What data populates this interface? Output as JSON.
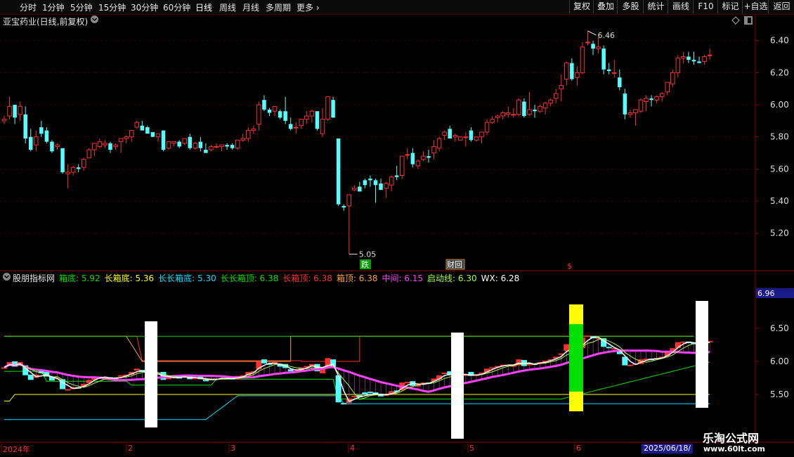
{
  "toolbar": {
    "periods": [
      "分时",
      "1分钟",
      "5分钟",
      "15分钟",
      "30分钟",
      "60分钟",
      "日线",
      "周线",
      "月线",
      "多周期",
      "更多 ›"
    ],
    "buttons": [
      "复权",
      "叠加",
      "多股",
      "统计",
      "画线",
      "F10",
      "标记",
      "+自选",
      "返回"
    ]
  },
  "main": {
    "title": "亚宝药业(日线,前复权)",
    "high_label": "6.46",
    "low_label": "5.05",
    "marker_die": "跌",
    "marker_caiji": "财回",
    "marker_s": "$",
    "y_ticks": [
      "6.40",
      "6.20",
      "6.00",
      "5.80",
      "5.60",
      "5.40",
      "5.20"
    ]
  },
  "indicator": {
    "name": "股朋指标网",
    "items": [
      {
        "label": "箱底:",
        "value": "5.92",
        "color": "#00e000"
      },
      {
        "label": "长箱底:",
        "value": "5.36",
        "color": "#ffff00"
      },
      {
        "label": "长长箱底:",
        "value": "5.30",
        "color": "#00e0ff"
      },
      {
        "label": "长长箱顶:",
        "value": "6.38",
        "color": "#00e000"
      },
      {
        "label": "长箱顶:",
        "value": "6.38",
        "color": "#ff3030"
      },
      {
        "label": "箱顶:",
        "value": "6.38",
        "color": "#ffa040"
      },
      {
        "label": "中间:",
        "value": "6.15",
        "color": "#ff40ff"
      },
      {
        "label": "启动线:",
        "value": "6.30",
        "color": "#a0ff40"
      },
      {
        "label": "WX:",
        "value": "6.28",
        "color": "#ffffff"
      }
    ],
    "y_ticks": [
      "6.96",
      "6.50",
      "6.00",
      "5.50"
    ]
  },
  "x_axis": {
    "labels": [
      "2024年",
      "2",
      "3",
      "4",
      "5",
      "6"
    ],
    "date_box": "2025/06/18/"
  },
  "watermark": {
    "line1": "乐淘公式网",
    "line2": "www.60lt.com"
  },
  "colors": {
    "up": "#ff3030",
    "down": "#54ffff",
    "grid": "#8b0000",
    "magenta": "#ff40ff"
  },
  "chart_data": {
    "type": "candlestick",
    "ylim": [
      5.05,
      6.46
    ],
    "ohlc": [
      [
        5.9,
        5.93,
        5.88,
        5.91
      ],
      [
        5.93,
        6.05,
        5.91,
        5.99
      ],
      [
        6.0,
        6.0,
        5.88,
        5.92
      ],
      [
        5.94,
        6.02,
        5.9,
        5.99
      ],
      [
        5.94,
        5.99,
        5.76,
        5.79
      ],
      [
        5.8,
        5.85,
        5.71,
        5.72
      ],
      [
        5.75,
        5.84,
        5.71,
        5.8
      ],
      [
        5.86,
        5.9,
        5.8,
        5.82
      ],
      [
        5.84,
        5.86,
        5.76,
        5.77
      ],
      [
        5.77,
        5.78,
        5.7,
        5.71
      ],
      [
        5.74,
        5.76,
        5.72,
        5.75
      ],
      [
        5.73,
        5.73,
        5.57,
        5.58
      ],
      [
        5.57,
        5.63,
        5.48,
        5.58
      ],
      [
        5.58,
        5.62,
        5.56,
        5.61
      ],
      [
        5.61,
        5.63,
        5.58,
        5.6
      ],
      [
        5.61,
        5.67,
        5.59,
        5.66
      ],
      [
        5.67,
        5.73,
        5.67,
        5.72
      ],
      [
        5.72,
        5.75,
        5.68,
        5.76
      ],
      [
        5.74,
        5.79,
        5.73,
        5.77
      ],
      [
        5.75,
        5.78,
        5.73,
        5.76
      ],
      [
        5.76,
        5.77,
        5.7,
        5.72
      ],
      [
        5.74,
        5.76,
        5.72,
        5.75
      ],
      [
        5.77,
        5.79,
        5.7,
        5.79
      ],
      [
        5.79,
        5.81,
        5.76,
        5.8
      ],
      [
        5.8,
        5.81,
        5.77,
        5.84
      ],
      [
        5.86,
        5.9,
        5.85,
        5.89
      ],
      [
        5.87,
        5.9,
        5.84,
        5.84
      ],
      [
        5.86,
        5.87,
        5.83,
        5.82
      ],
      [
        5.83,
        5.83,
        5.8,
        5.8
      ],
      [
        5.8,
        5.81,
        5.77,
        5.82
      ],
      [
        5.84,
        5.84,
        5.71,
        5.72
      ],
      [
        5.73,
        5.77,
        5.72,
        5.77
      ],
      [
        5.76,
        5.77,
        5.74,
        5.77
      ],
      [
        5.77,
        5.78,
        5.73,
        5.74
      ],
      [
        5.76,
        5.79,
        5.75,
        5.79
      ],
      [
        5.8,
        5.82,
        5.72,
        5.73
      ],
      [
        5.73,
        5.77,
        5.72,
        5.76
      ],
      [
        5.77,
        5.8,
        5.71,
        5.73
      ],
      [
        5.72,
        5.76,
        5.7,
        5.7
      ],
      [
        5.72,
        5.75,
        5.71,
        5.74
      ],
      [
        5.74,
        5.76,
        5.73,
        5.74
      ],
      [
        5.74,
        5.75,
        5.71,
        5.75
      ],
      [
        5.75,
        5.76,
        5.72,
        5.74
      ],
      [
        5.75,
        5.76,
        5.72,
        5.73
      ],
      [
        5.73,
        5.78,
        5.72,
        5.78
      ],
      [
        5.78,
        5.82,
        5.77,
        5.79
      ],
      [
        5.79,
        5.86,
        5.77,
        5.84
      ],
      [
        5.84,
        5.87,
        5.82,
        5.85
      ],
      [
        5.88,
        6.02,
        5.84,
        6.0
      ],
      [
        6.03,
        6.06,
        5.96,
        5.97
      ],
      [
        5.97,
        5.98,
        5.93,
        5.95
      ],
      [
        5.96,
        5.99,
        5.93,
        5.99
      ],
      [
        5.96,
        5.97,
        5.91,
        5.92
      ],
      [
        5.96,
        6.05,
        5.88,
        5.9
      ],
      [
        5.88,
        5.92,
        5.84,
        5.85
      ],
      [
        5.86,
        5.89,
        5.82,
        5.86
      ],
      [
        5.87,
        5.91,
        5.85,
        5.91
      ],
      [
        5.91,
        5.96,
        5.88,
        5.93
      ],
      [
        5.93,
        5.97,
        5.89,
        5.96
      ],
      [
        5.96,
        5.96,
        5.84,
        5.85
      ],
      [
        5.82,
        5.98,
        5.8,
        5.91
      ],
      [
        5.91,
        6.04,
        5.9,
        6.05
      ],
      [
        6.03,
        6.05,
        5.92,
        5.92
      ],
      [
        5.79,
        5.79,
        5.37,
        5.38
      ],
      [
        5.37,
        5.38,
        5.34,
        5.36
      ],
      [
        5.37,
        5.43,
        5.07,
        5.44
      ],
      [
        5.47,
        5.5,
        5.46,
        5.48
      ],
      [
        5.49,
        5.52,
        5.46,
        5.46
      ],
      [
        5.53,
        5.54,
        5.48,
        5.5
      ],
      [
        5.54,
        5.56,
        5.49,
        5.53
      ],
      [
        5.53,
        5.54,
        5.39,
        5.5
      ],
      [
        5.51,
        5.54,
        5.48,
        5.47
      ],
      [
        5.48,
        5.52,
        5.42,
        5.51
      ],
      [
        5.5,
        5.56,
        5.46,
        5.55
      ],
      [
        5.56,
        5.62,
        5.53,
        5.55
      ],
      [
        5.56,
        5.63,
        5.54,
        5.68
      ],
      [
        5.69,
        5.73,
        5.66,
        5.69
      ],
      [
        5.7,
        5.73,
        5.61,
        5.63
      ],
      [
        5.62,
        5.66,
        5.6,
        5.65
      ],
      [
        5.66,
        5.71,
        5.65,
        5.68
      ],
      [
        5.68,
        5.72,
        5.64,
        5.67
      ],
      [
        5.7,
        5.78,
        5.66,
        5.74
      ],
      [
        5.73,
        5.8,
        5.71,
        5.79
      ],
      [
        5.81,
        5.84,
        5.78,
        5.83
      ],
      [
        5.85,
        5.87,
        5.79,
        5.79
      ],
      [
        5.8,
        5.82,
        5.77,
        5.81
      ],
      [
        5.78,
        5.8,
        5.78,
        5.8
      ],
      [
        5.8,
        5.83,
        5.74,
        5.8
      ],
      [
        5.84,
        5.86,
        5.77,
        5.78
      ],
      [
        5.78,
        5.8,
        5.77,
        5.8
      ],
      [
        5.8,
        5.83,
        5.76,
        5.83
      ],
      [
        5.83,
        5.91,
        5.81,
        5.89
      ],
      [
        5.89,
        5.93,
        5.88,
        5.91
      ],
      [
        5.92,
        5.94,
        5.89,
        5.93
      ],
      [
        5.93,
        5.96,
        5.91,
        5.95
      ],
      [
        5.94,
        5.99,
        5.92,
        5.95
      ],
      [
        5.94,
        5.98,
        5.92,
        5.94
      ],
      [
        5.94,
        6.04,
        5.93,
        6.03
      ],
      [
        6.02,
        6.04,
        5.92,
        5.93
      ],
      [
        5.94,
        6.08,
        5.93,
        5.97
      ],
      [
        5.97,
        6.0,
        5.92,
        5.96
      ],
      [
        5.96,
        6.0,
        5.95,
        5.99
      ],
      [
        5.98,
        6.02,
        5.94,
        6.01
      ],
      [
        6.01,
        6.04,
        5.99,
        6.03
      ],
      [
        6.04,
        6.1,
        6.01,
        6.07
      ],
      [
        6.1,
        6.19,
        6.02,
        6.12
      ],
      [
        6.16,
        6.27,
        6.12,
        6.26
      ],
      [
        6.26,
        6.29,
        6.15,
        6.16
      ],
      [
        6.17,
        6.24,
        6.12,
        6.2
      ],
      [
        6.2,
        6.39,
        6.19,
        6.36
      ],
      [
        6.39,
        6.46,
        6.37,
        6.39
      ],
      [
        6.38,
        6.4,
        6.31,
        6.35
      ],
      [
        6.35,
        6.42,
        6.32,
        6.36
      ],
      [
        6.35,
        6.37,
        6.19,
        6.22
      ],
      [
        6.22,
        6.26,
        6.19,
        6.21
      ],
      [
        6.2,
        6.28,
        6.17,
        6.2
      ],
      [
        6.17,
        6.22,
        6.09,
        6.11
      ],
      [
        6.07,
        6.1,
        5.91,
        5.94
      ],
      [
        5.94,
        5.97,
        5.92,
        5.95
      ],
      [
        5.95,
        5.96,
        5.87,
        5.97
      ],
      [
        5.96,
        6.04,
        5.95,
        6.03
      ],
      [
        6.02,
        6.06,
        5.96,
        6.04
      ],
      [
        6.04,
        6.06,
        5.99,
        6.03
      ],
      [
        6.03,
        6.06,
        6.01,
        6.05
      ],
      [
        6.05,
        6.08,
        6.02,
        6.07
      ],
      [
        6.08,
        6.11,
        6.06,
        6.14
      ],
      [
        6.13,
        6.22,
        6.11,
        6.2
      ],
      [
        6.2,
        6.31,
        6.17,
        6.29
      ],
      [
        6.29,
        6.33,
        6.26,
        6.3
      ],
      [
        6.3,
        6.33,
        6.26,
        6.28
      ],
      [
        6.28,
        6.33,
        6.25,
        6.27
      ],
      [
        6.27,
        6.3,
        6.26,
        6.26
      ],
      [
        6.27,
        6.31,
        6.25,
        6.3
      ],
      [
        6.31,
        6.35,
        6.28,
        6.31
      ]
    ]
  }
}
